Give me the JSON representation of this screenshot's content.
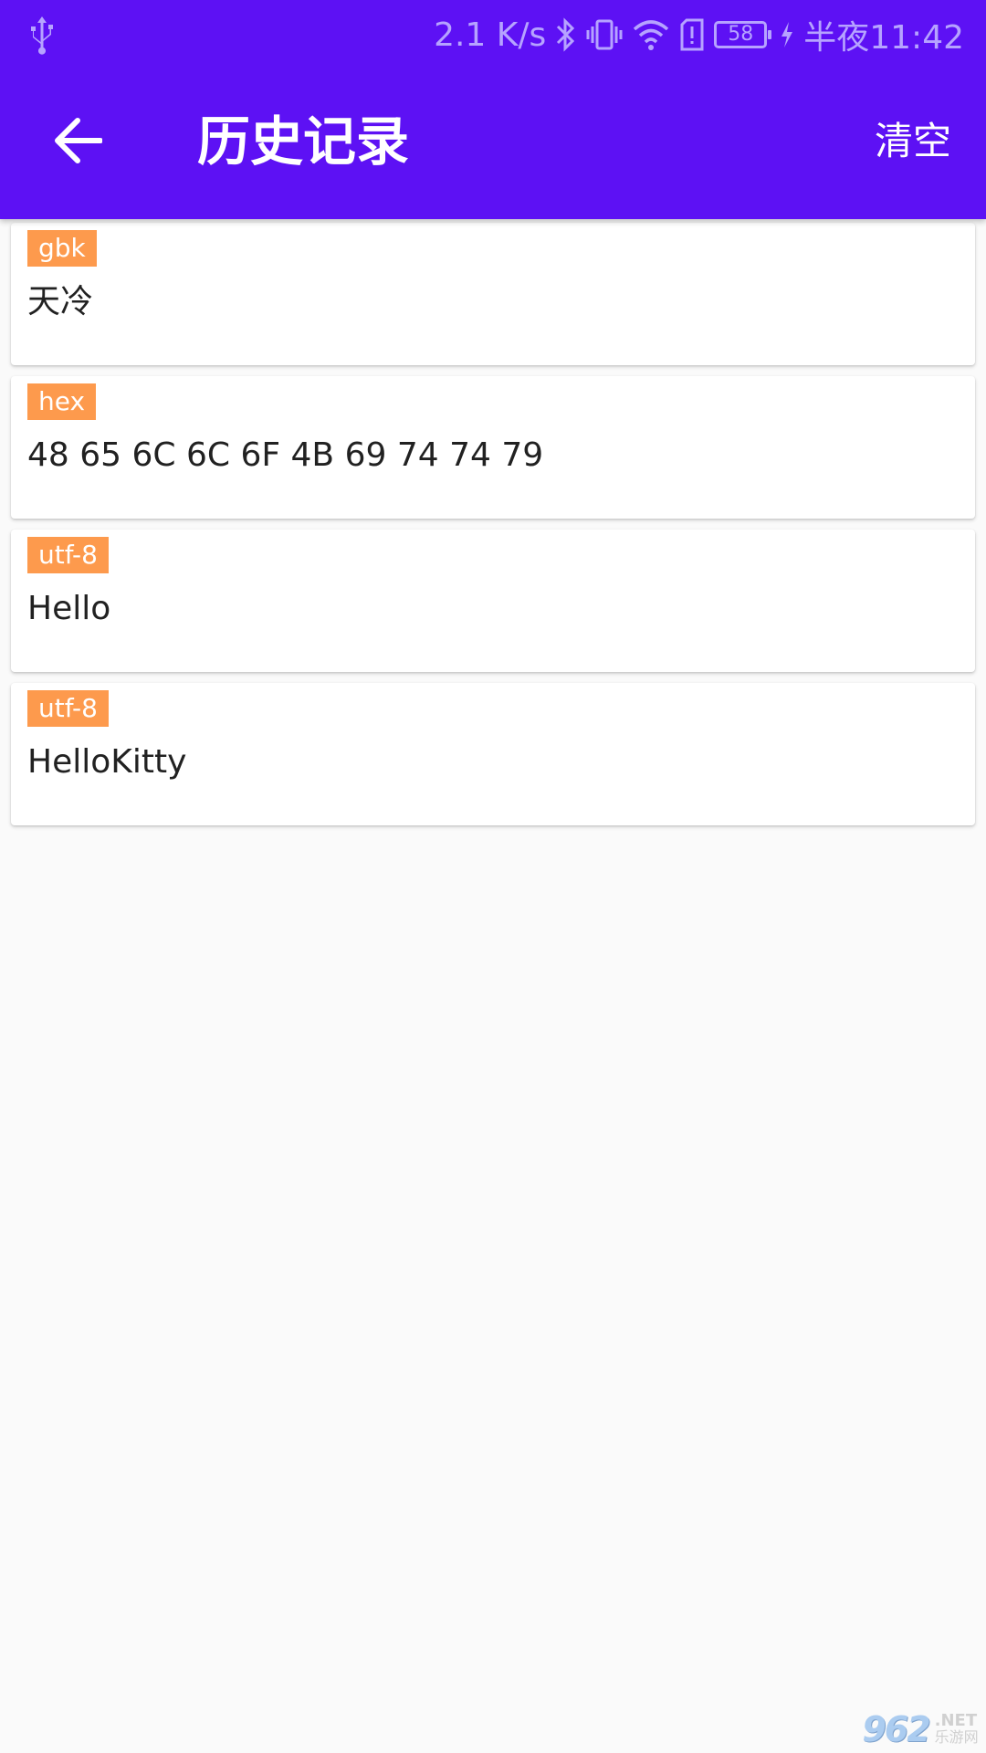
{
  "status_bar": {
    "net_speed": "2.1 K/s",
    "battery_level": "58",
    "time": "半夜11:42",
    "icons": [
      "usb-icon",
      "bluetooth-icon",
      "vibrate-icon",
      "wifi-icon",
      "sim-alert-icon",
      "battery-icon",
      "charging-icon"
    ]
  },
  "header": {
    "title": "历史记录",
    "back_icon": "arrow-back-icon",
    "clear_label": "清空"
  },
  "history": {
    "items": [
      {
        "encoding": "gbk",
        "text": "天冷"
      },
      {
        "encoding": "hex",
        "text": "48 65 6C 6C 6F 4B 69 74 74 79"
      },
      {
        "encoding": "utf-8",
        "text": "Hello"
      },
      {
        "encoding": "utf-8",
        "text": "HelloKitty"
      }
    ]
  },
  "watermark": {
    "number": "962",
    "suffix": ".NET",
    "cn": "乐游网"
  },
  "colors": {
    "primary": "#5d11f4",
    "status_text": "#b6a3ff",
    "tag_bg": "#fd9a4d",
    "background": "#fafafa",
    "card_bg": "#ffffff",
    "text": "#212121"
  }
}
